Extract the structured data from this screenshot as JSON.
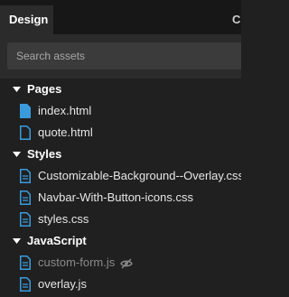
{
  "tabs": {
    "active_label": "Design",
    "partial_label": "C"
  },
  "search": {
    "placeholder": "Search assets"
  },
  "sections": [
    {
      "label": "Pages",
      "expanded": true,
      "files": [
        {
          "name": "index.html",
          "icon": "filled-page-icon"
        },
        {
          "name": "quote.html",
          "icon": "outline-page-icon"
        }
      ]
    },
    {
      "label": "Styles",
      "expanded": true,
      "files": [
        {
          "name": "Customizable-Background--Overlay.css",
          "icon": "css-file-icon"
        },
        {
          "name": "Navbar-With-Button-icons.css",
          "icon": "css-file-icon"
        },
        {
          "name": "styles.css",
          "icon": "css-file-icon"
        }
      ]
    },
    {
      "label": "JavaScript",
      "expanded": true,
      "files": [
        {
          "name": "custom-form.js",
          "icon": "js-file-icon",
          "hidden": true
        },
        {
          "name": "overlay.js",
          "icon": "js-file-icon"
        }
      ]
    }
  ],
  "colors": {
    "accent": "#3a9bdc",
    "background": "#202020",
    "search_bg": "#3b3b3b",
    "tab_bar": "#171717",
    "active_tab": "#2b2b2b",
    "hidden_text": "#8a8a8a"
  }
}
